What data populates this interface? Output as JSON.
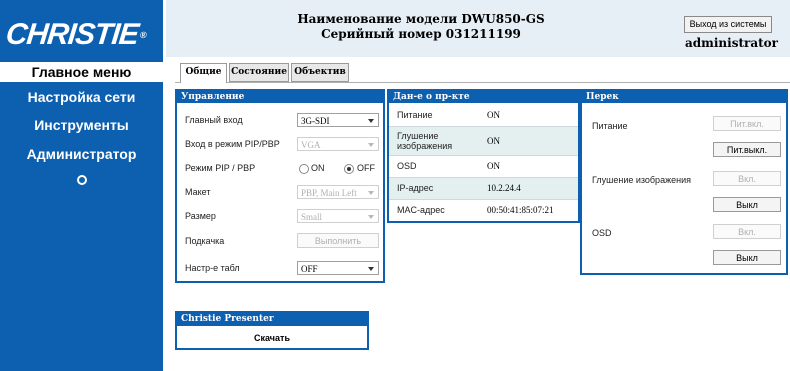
{
  "brand": {
    "logo_text": "CHRISTIE",
    "trademark": "®"
  },
  "header": {
    "model_line": "Наименование модели DWU850-GS",
    "serial_line": "Серийный номер 031211199",
    "logout_label": "Выход из системы",
    "username": "administrator"
  },
  "sidebar": {
    "items": [
      {
        "label": "Главное меню",
        "active": true
      },
      {
        "label": "Настройка сети"
      },
      {
        "label": "Инструменты"
      },
      {
        "label": "Администратор"
      }
    ],
    "extra_icon": "circle-icon"
  },
  "tabs": [
    {
      "label": "Общие",
      "active": true
    },
    {
      "label": "Состояние"
    },
    {
      "label": "Объектив"
    }
  ],
  "control_panel": {
    "title": "Управление",
    "main_input_label": "Главный вход",
    "main_input_value": "3G-SDI",
    "pip_input_label": "Вход в режим PIP/PBP",
    "pip_input_value": "VGA",
    "pip_mode_label": "Режим PIP / PBP",
    "pip_on_label": "ON",
    "pip_off_label": "OFF",
    "pip_mode_selected": "OFF",
    "layout_label": "Макет",
    "layout_value": "PBP, Main Left",
    "size_label": "Размер",
    "size_value": "Small",
    "swap_label": "Подкачка",
    "swap_button": "Выполнить",
    "table_setup_label": "Настр-е табл",
    "table_setup_value": "OFF"
  },
  "info_panel": {
    "title": "Дан-е о пр-кте",
    "rows": [
      {
        "label": "Питание",
        "value": "ON"
      },
      {
        "label": "Глушение изображения",
        "value": "ON"
      },
      {
        "label": "OSD",
        "value": "ON"
      },
      {
        "label": "IP-адрес",
        "value": "10.2.24.4"
      },
      {
        "label": "MAC-адрес",
        "value": "00:50:41:85:07:21"
      }
    ]
  },
  "switch_panel": {
    "title": "Перек",
    "power_label": "Питание",
    "power_on_button": "Пит.вкл.",
    "power_off_button": "Пит.выкл.",
    "mute_label": "Глушение изображения",
    "mute_on_button": "Вкл.",
    "mute_off_button": "Выкл",
    "osd_label": "OSD",
    "osd_on_button": "Вкл.",
    "osd_off_button": "Выкл"
  },
  "presenter_panel": {
    "title": "Christie Presenter",
    "download_label": "Скачать"
  },
  "colors": {
    "brand_blue": "#0d5fb0",
    "row_shade": "#e4f0f0",
    "header_bg": "#e6eef6"
  }
}
